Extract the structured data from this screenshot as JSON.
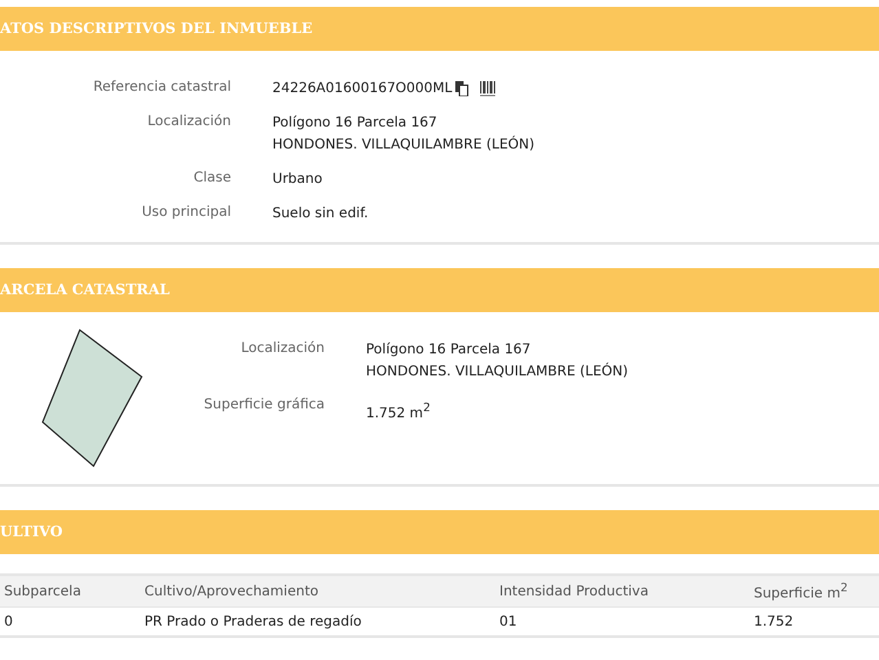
{
  "sections": [
    {
      "title": "ATOS DESCRIPTIVOS DEL INMUEBLE",
      "kind": "fields",
      "fields": [
        {
          "label": "Referencia catastral",
          "lines": [
            "24226A01600167O000ML"
          ],
          "icons": true
        },
        {
          "label": "Localización",
          "lines": [
            "Polígono 16 Parcela 167",
            "HONDONES. VILLAQUILAMBRE (LEÓN)"
          ]
        },
        {
          "label": "Clase",
          "lines": [
            "Urbano"
          ]
        },
        {
          "label": "Uso principal",
          "lines": [
            "Suelo sin edif."
          ]
        }
      ]
    },
    {
      "title": "ARCELA CATASTRAL",
      "kind": "parcel",
      "fields": [
        {
          "label": "Localización",
          "lines": [
            "Polígono 16 Parcela 167",
            "HONDONES. VILLAQUILAMBRE (LEÓN)"
          ]
        },
        {
          "label": "Superficie gráfica",
          "lines": [
            "1.752 m$^{2}$"
          ]
        }
      ]
    },
    {
      "title": "ULTIVO",
      "kind": "table",
      "columns": [
        "Subparcela",
        "Cultivo/Aprovechamiento",
        "Intensidad Productiva",
        "Superficie m$^{2}$"
      ],
      "rows": [
        [
          "0",
          "PR Prado o Praderas de regadío",
          "01",
          "1.752"
        ]
      ]
    }
  ]
}
